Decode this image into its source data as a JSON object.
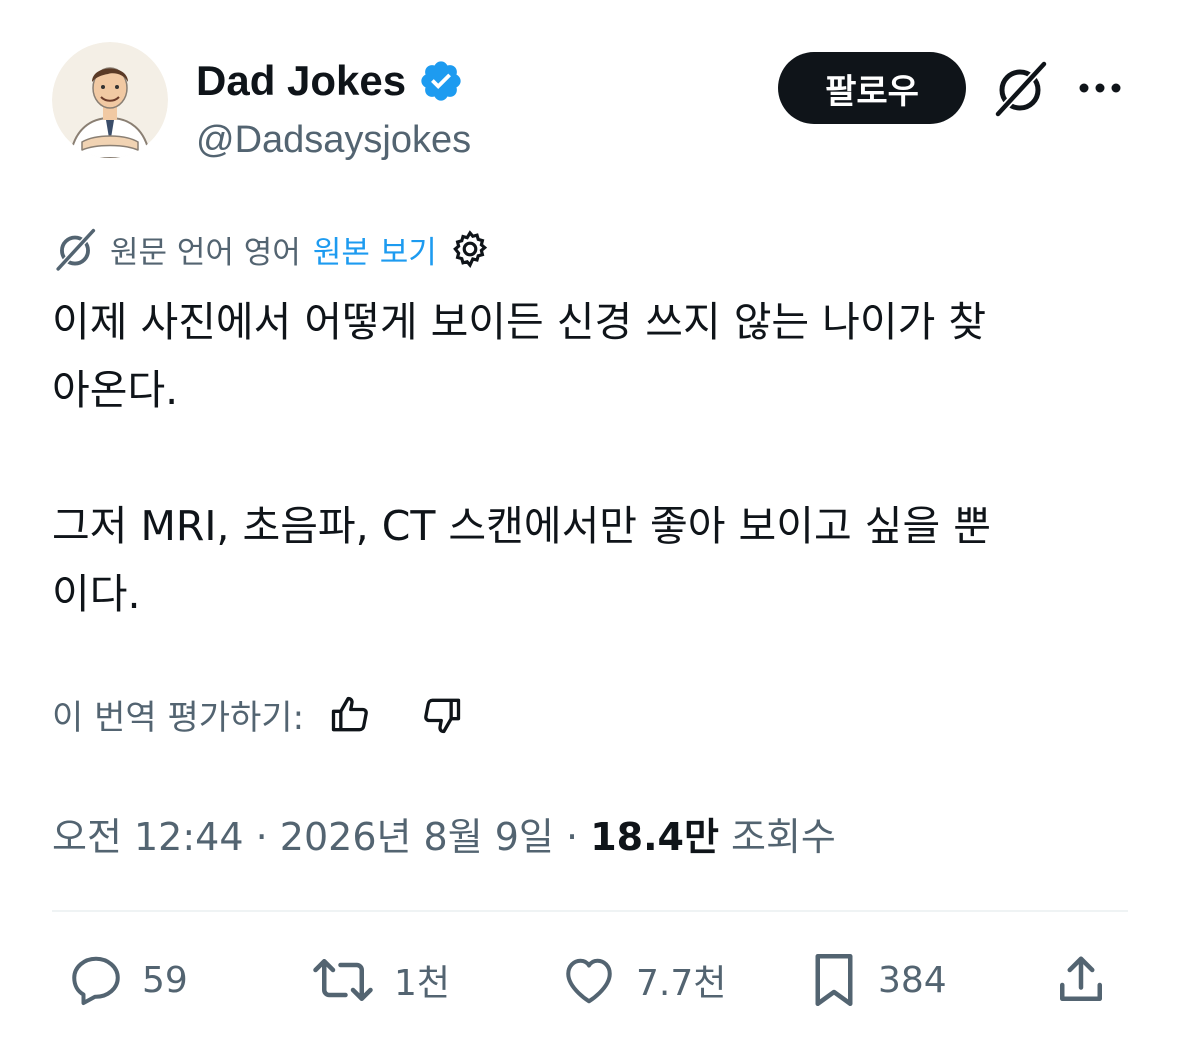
{
  "account": {
    "display_name": "Dad Jokes",
    "handle": "@Dadsaysjokes",
    "verified_icon": "verified-badge-icon",
    "brand_color": "#1d9bf0"
  },
  "header": {
    "follow_label": "팔로우"
  },
  "translation": {
    "source_lang_text": "원문 언어 영어",
    "view_original_label": "원본 보기"
  },
  "tweet": {
    "text": "이제 사진에서 어떻게 보이든 신경 쓰지 않는 나이가 찾\n아온다.\n\n그저 MRI, 초음파, CT 스캔에서만 좋아 보이고 싶을 뿐\n이다."
  },
  "rating": {
    "label": "이 번역 평가하기:"
  },
  "meta": {
    "time": "오전 12:44",
    "separator": "·",
    "date": "2026년 8월 9일",
    "views_count": "18.4만",
    "views_label": "조회수"
  },
  "actions": {
    "replies": "59",
    "reposts": "1천",
    "likes": "7.7천",
    "bookmarks": "384"
  },
  "colors": {
    "text": "#0f1419",
    "secondary": "#536471",
    "link": "#1d9bf0",
    "divider": "#eff3f4"
  }
}
